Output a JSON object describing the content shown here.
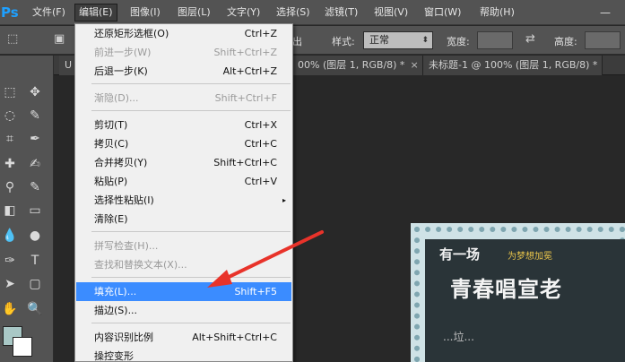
{
  "app": {
    "logo": "Ps"
  },
  "menubar": {
    "items": [
      {
        "label": "文件(F)"
      },
      {
        "label": "编辑(E)"
      },
      {
        "label": "图像(I)"
      },
      {
        "label": "图层(L)"
      },
      {
        "label": "文字(Y)"
      },
      {
        "label": "选择(S)"
      },
      {
        "label": "滤镜(T)"
      },
      {
        "label": "视图(V)"
      },
      {
        "label": "窗口(W)"
      },
      {
        "label": "帮助(H)"
      }
    ],
    "minimize": "—"
  },
  "options": {
    "partial_text": "出",
    "style_label": "样式:",
    "style_value": "正常",
    "width_label": "宽度:",
    "height_label": "高度:"
  },
  "tabs": [
    {
      "label": "U",
      "close": ""
    },
    {
      "label": "00% (图层 1, RGB/8) *",
      "close": "×"
    },
    {
      "label": "未标题-1 @ 100% (图层 1, RGB/8) *",
      "close": "×"
    }
  ],
  "document": {
    "line1": "有一场",
    "line1b": "为梦想加冕",
    "line2": "青春唱宣老",
    "line3": "...垃..."
  },
  "edit_menu": {
    "items": [
      {
        "label": "还原矩形选框(O)",
        "shortcut": "Ctrl+Z"
      },
      {
        "label": "前进一步(W)",
        "shortcut": "Shift+Ctrl+Z"
      },
      {
        "label": "后退一步(K)",
        "shortcut": "Alt+Ctrl+Z"
      },
      {
        "label": "渐隐(D)...",
        "shortcut": "Shift+Ctrl+F"
      },
      {
        "label": "剪切(T)",
        "shortcut": "Ctrl+X"
      },
      {
        "label": "拷贝(C)",
        "shortcut": "Ctrl+C"
      },
      {
        "label": "合并拷贝(Y)",
        "shortcut": "Shift+Ctrl+C"
      },
      {
        "label": "粘贴(P)",
        "shortcut": "Ctrl+V"
      },
      {
        "label": "选择性粘贴(I)",
        "shortcut": ""
      },
      {
        "label": "清除(E)",
        "shortcut": ""
      },
      {
        "label": "拼写检查(H)...",
        "shortcut": ""
      },
      {
        "label": "查找和替换文本(X)...",
        "shortcut": ""
      },
      {
        "label": "填充(L)...",
        "shortcut": "Shift+F5"
      },
      {
        "label": "描边(S)...",
        "shortcut": ""
      },
      {
        "label": "内容识别比例",
        "shortcut": "Alt+Shift+Ctrl+C"
      },
      {
        "label": "操控变形",
        "shortcut": ""
      }
    ],
    "submenu_arrow": "▸"
  },
  "colors": {
    "highlight": "#3b8cff",
    "arrow": "#e8332a",
    "foreground_swatch": "#a9c8c6",
    "background_swatch": "#ffffff"
  }
}
